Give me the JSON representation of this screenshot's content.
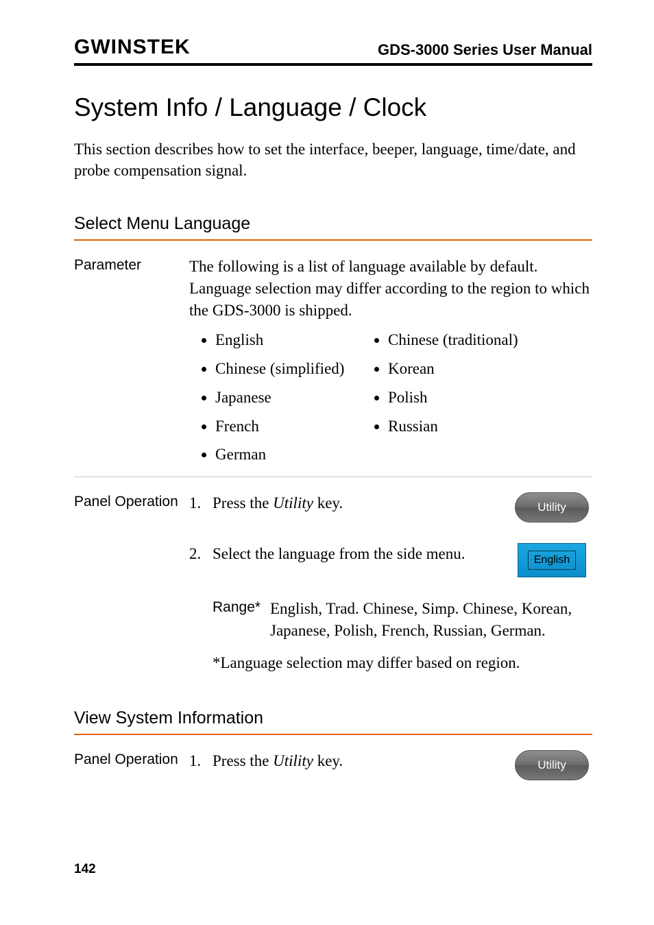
{
  "header": {
    "logo_text": "GWINSTEK",
    "manual_title": "GDS-3000 Series User Manual"
  },
  "title": "System Info / Language / Clock",
  "intro": "This section describes how to set the interface, beeper, language, time/date, and probe compensation signal.",
  "sec1": {
    "heading": "Select Menu Language",
    "param_label": "Parameter",
    "param_text": "The following is a list of language available by default. Language selection may differ according to the region to which the GDS-3000 is shipped.",
    "langs_a": [
      "English",
      "Chinese (simplified)",
      "Japanese",
      "French",
      "German"
    ],
    "langs_b": [
      "Chinese (traditional)",
      "Korean",
      "Polish",
      "Russian"
    ],
    "panel_label": "Panel Operation",
    "step1_num": "1.",
    "step1_a": "Press the ",
    "step1_b": "Utility",
    "step1_c": " key.",
    "step2_num": "2.",
    "step2_text": "Select the language from the side menu.",
    "utility_btn": "Utility",
    "english_btn": "English",
    "range_label": "Range*",
    "range_text": "English, Trad. Chinese, Simp. Chinese, Korean, Japanese, Polish, French, Russian, German.",
    "footnote": "*Language selection may differ based on region."
  },
  "sec2": {
    "heading": "View System Information",
    "panel_label": "Panel Operation",
    "step1_num": "1.",
    "step1_a": "Press the ",
    "step1_b": "Utility",
    "step1_c": " key.",
    "utility_btn": "Utility"
  },
  "page_number": "142"
}
